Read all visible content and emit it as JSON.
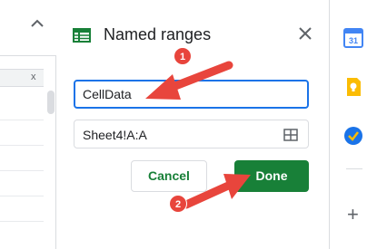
{
  "grid": {
    "caret_icon": "chevron-up-icon",
    "close_glyph": "x"
  },
  "panel": {
    "title": "Named ranges",
    "name_input_value": "CellData",
    "range_value": "Sheet4!A:A",
    "cancel_label": "Cancel",
    "done_label": "Done"
  },
  "annotations": {
    "step1": "1",
    "step2": "2",
    "arrow_color": "#e8453c"
  },
  "rail": {
    "icons": [
      "google-calendar-icon",
      "google-keep-icon",
      "google-tasks-icon",
      "add-icon"
    ]
  },
  "colors": {
    "accent_green": "#188038",
    "focus_blue": "#1a73e8"
  }
}
